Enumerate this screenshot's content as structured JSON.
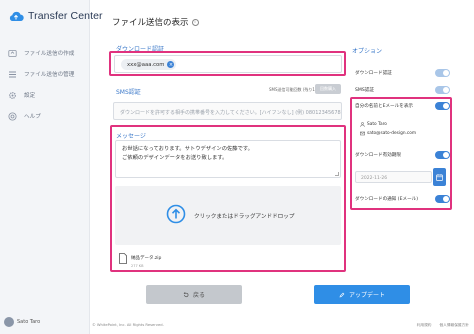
{
  "app": {
    "name": "Transfer Center"
  },
  "sidebar": {
    "items": [
      {
        "label": "ファイル送信の作成",
        "icon": "upload-icon"
      },
      {
        "label": "ファイル送信の管理",
        "icon": "list-icon"
      },
      {
        "label": "設定",
        "icon": "gear-icon"
      },
      {
        "label": "ヘルプ",
        "icon": "help-icon"
      }
    ],
    "user": "Sato Taro"
  },
  "page": {
    "title": "ファイル送信の表示"
  },
  "download_auth": {
    "label": "ダウンロード認証",
    "chip": "xxx@aaa.com"
  },
  "sms_auth": {
    "label": "SMS認証",
    "note": "SMS送信可能回数 (残り100回)",
    "button": "回数購入",
    "placeholder": "ダウンロードを許可する相手の携帯番号を入力してください。[ハイフンなし] (例) 08012345678"
  },
  "message": {
    "label": "メッセージ",
    "lines": [
      "お世話になっております。サトウデザインの佐藤です。",
      "ご依頼のデザインデータをお送り致します。"
    ]
  },
  "dropzone": {
    "text": "クリックまたはドラッグアンドドロップ"
  },
  "file": {
    "name": "納品データ.zip",
    "size": "277 KB"
  },
  "buttons": {
    "back": "戻る",
    "update": "アップデート"
  },
  "options": {
    "label": "オプション",
    "download_auth": "ダウンロード認証",
    "sms_auth": "SMS認証",
    "show_name_email": "自分の名前とEメールを表示",
    "name": "Sato Taro",
    "email": "sato@sato-design.com",
    "expiry": "ダウンロード有効期限",
    "date": "2022-11-26",
    "notify": "ダウンロードの通知 (Eメール)"
  },
  "colors": {
    "accent": "#3b82d6",
    "highlight": "#e0327e"
  },
  "footer": {
    "copyright": "© WhitePoint, Inc. All Rights Reserved.",
    "terms": "利用規約",
    "privacy": "個人情報保護方針"
  }
}
